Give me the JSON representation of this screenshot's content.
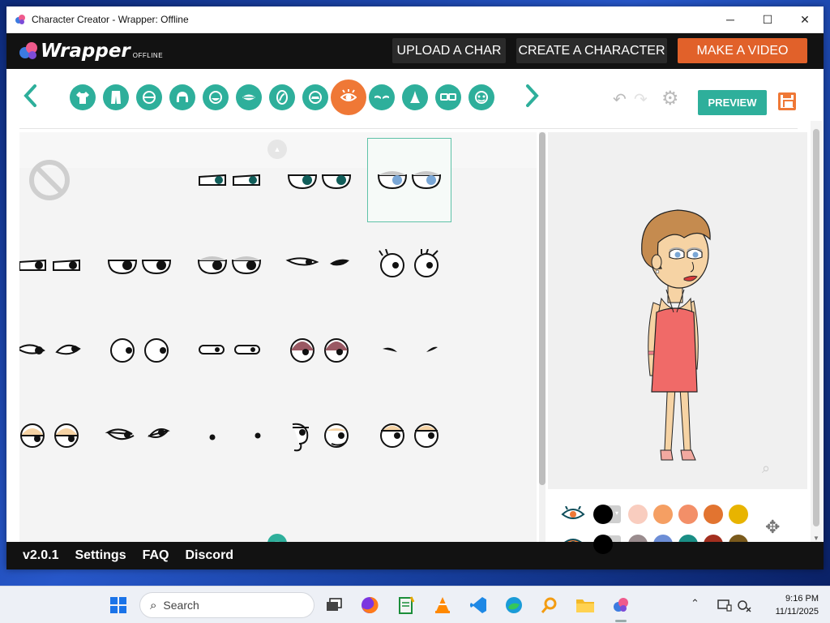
{
  "window": {
    "title": "Character Creator - Wrapper: Offline",
    "minimize": "─",
    "maximize": "☐",
    "close": "✕"
  },
  "brand": {
    "name": "Wrapper",
    "sub": "OFFLINE"
  },
  "nav": {
    "upload": "UPLOAD A CHAR",
    "create": "CREATE A CHARACTER",
    "make": "MAKE A VIDEO"
  },
  "toolbar": {
    "prev": "‹",
    "next": "›",
    "undo": "↶",
    "redo": "↷",
    "settings": "⚙",
    "preview": "PREVIEW",
    "categories": [
      "shirt-icon",
      "pants-icon",
      "face-shape-icon",
      "hair-icon",
      "lower-face-icon",
      "mouth-icon",
      "cheek-icon",
      "ear-icon",
      "eye-icon",
      "eyebrow-icon",
      "nose-icon",
      "glasses-icon",
      "face-accessory-icon"
    ],
    "active_category": "eye-icon"
  },
  "colors": {
    "accent": "#2eaf9b",
    "orange": "#ef7836",
    "selected_border": "#5fc2a8",
    "row1": [
      "#000000",
      "#f9cdbf",
      "#f59f63",
      "#f38f68",
      "#e27430",
      "#e8b400"
    ],
    "row2": [
      "#000000",
      "#9a8c8e",
      "#6d8ed6",
      "#1a8e85",
      "#a32f1f",
      "#7a5a1c"
    ]
  },
  "grid": {
    "scroll_up": "▲",
    "scroll_down": "▼",
    "selected_index": 3,
    "rows": [
      [
        "none",
        "flat-teal",
        "round-teal",
        "blue-lidded"
      ],
      [
        "flat-black",
        "round-black",
        "lidded-black",
        "lash-black",
        "lash-wide"
      ],
      [
        "side-glance",
        "round-open",
        "narrow",
        "pink-lidded",
        "brow-only"
      ],
      [
        "peach-lidded",
        "lash-closed",
        "dots",
        "swirl",
        "peach-wide"
      ]
    ]
  },
  "footer": {
    "version": "v2.0.1",
    "settings": "Settings",
    "faq": "FAQ",
    "discord": "Discord"
  },
  "taskbar": {
    "search": "Search",
    "time": "9:16 PM",
    "date": "11/11/2025"
  }
}
